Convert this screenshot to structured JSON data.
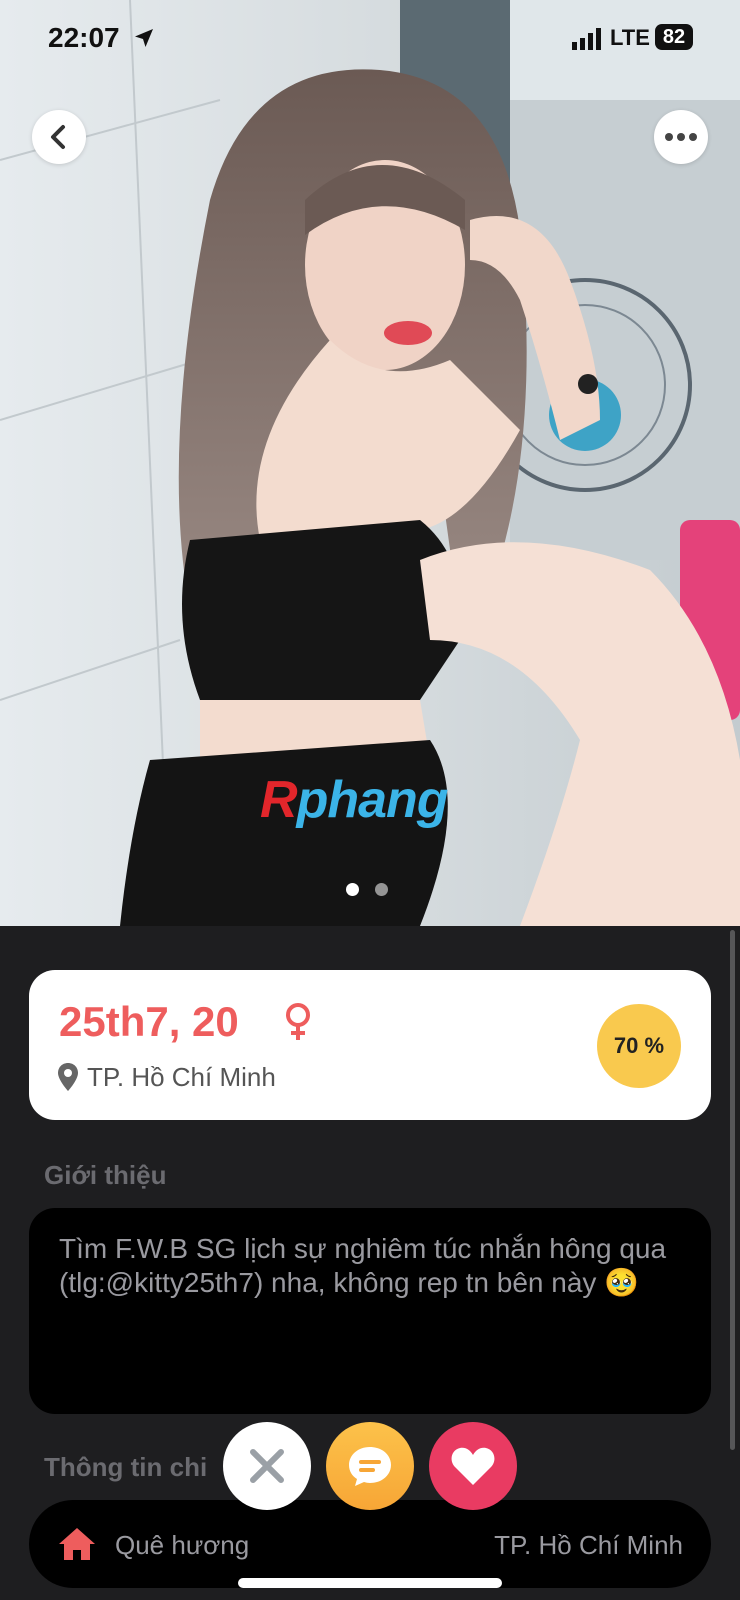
{
  "status_bar": {
    "time": "22:07",
    "network": "LTE",
    "battery": "82"
  },
  "photo": {
    "watermark_r": "R",
    "watermark_rest": "phang",
    "dots": [
      {
        "active": true
      },
      {
        "active": false
      }
    ]
  },
  "profile": {
    "name_age": "25th7, 20",
    "gender_icon": "female-icon",
    "location": "TP. Hồ Chí Minh",
    "match_percent": "70 %"
  },
  "intro": {
    "title": "Giới thiệu",
    "text": "Tìm F.W.B SG lịch sự nghiêm túc nhắn hông qua (tlg:@kitty25th7) nha, không rep tn bên này 🥹"
  },
  "info": {
    "title": "Thông tin chi",
    "rows": [
      {
        "icon": "home-icon",
        "label": "Quê hương",
        "value": "TP. Hồ Chí Minh"
      }
    ]
  },
  "actions": [
    "dislike",
    "chat",
    "like"
  ],
  "colors": {
    "name": "#ee5d5d",
    "match_badge": "#f9c94e",
    "chat": "#f7a636",
    "like": "#e93b62",
    "background": "#1e1e20"
  }
}
